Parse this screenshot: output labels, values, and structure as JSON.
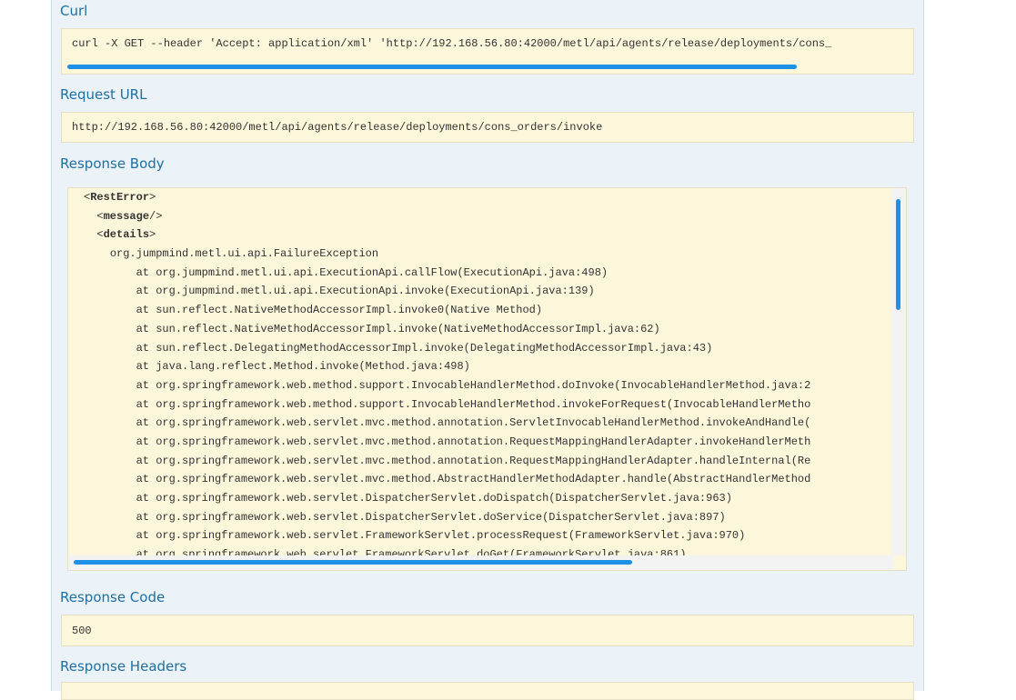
{
  "sections": {
    "curl": {
      "heading": "Curl",
      "command": "curl -X GET --header 'Accept: application/xml' 'http://192.168.56.80:42000/metl/api/agents/release/deployments/cons_"
    },
    "request_url": {
      "heading": "Request URL",
      "value": "http://192.168.56.80:42000/metl/api/agents/release/deployments/cons_orders/invoke"
    },
    "response_body": {
      "heading": "Response Body",
      "lines": [
        {
          "indent": "",
          "open": "<",
          "tag": "RestError",
          "close": ">",
          "text": ""
        },
        {
          "indent": "  ",
          "open": "<",
          "tag": "message",
          "close": "/>",
          "text": ""
        },
        {
          "indent": "  ",
          "open": "<",
          "tag": "details",
          "close": ">",
          "text": ""
        },
        {
          "indent": "    ",
          "open": "",
          "tag": "",
          "close": "",
          "text": "org.jumpmind.metl.ui.api.FailureException"
        },
        {
          "indent": "        ",
          "open": "",
          "tag": "",
          "close": "",
          "text": "at org.jumpmind.metl.ui.api.ExecutionApi.callFlow(ExecutionApi.java:498)"
        },
        {
          "indent": "        ",
          "open": "",
          "tag": "",
          "close": "",
          "text": "at org.jumpmind.metl.ui.api.ExecutionApi.invoke(ExecutionApi.java:139)"
        },
        {
          "indent": "        ",
          "open": "",
          "tag": "",
          "close": "",
          "text": "at sun.reflect.NativeMethodAccessorImpl.invoke0(Native Method)"
        },
        {
          "indent": "        ",
          "open": "",
          "tag": "",
          "close": "",
          "text": "at sun.reflect.NativeMethodAccessorImpl.invoke(NativeMethodAccessorImpl.java:62)"
        },
        {
          "indent": "        ",
          "open": "",
          "tag": "",
          "close": "",
          "text": "at sun.reflect.DelegatingMethodAccessorImpl.invoke(DelegatingMethodAccessorImpl.java:43)"
        },
        {
          "indent": "        ",
          "open": "",
          "tag": "",
          "close": "",
          "text": "at java.lang.reflect.Method.invoke(Method.java:498)"
        },
        {
          "indent": "        ",
          "open": "",
          "tag": "",
          "close": "",
          "text": "at org.springframework.web.method.support.InvocableHandlerMethod.doInvoke(InvocableHandlerMethod.java:2"
        },
        {
          "indent": "        ",
          "open": "",
          "tag": "",
          "close": "",
          "text": "at org.springframework.web.method.support.InvocableHandlerMethod.invokeForRequest(InvocableHandlerMetho"
        },
        {
          "indent": "        ",
          "open": "",
          "tag": "",
          "close": "",
          "text": "at org.springframework.web.servlet.mvc.method.annotation.ServletInvocableHandlerMethod.invokeAndHandle("
        },
        {
          "indent": "        ",
          "open": "",
          "tag": "",
          "close": "",
          "text": "at org.springframework.web.servlet.mvc.method.annotation.RequestMappingHandlerAdapter.invokeHandlerMeth"
        },
        {
          "indent": "        ",
          "open": "",
          "tag": "",
          "close": "",
          "text": "at org.springframework.web.servlet.mvc.method.annotation.RequestMappingHandlerAdapter.handleInternal(Re"
        },
        {
          "indent": "        ",
          "open": "",
          "tag": "",
          "close": "",
          "text": "at org.springframework.web.servlet.mvc.method.AbstractHandlerMethodAdapter.handle(AbstractHandlerMethod"
        },
        {
          "indent": "        ",
          "open": "",
          "tag": "",
          "close": "",
          "text": "at org.springframework.web.servlet.DispatcherServlet.doDispatch(DispatcherServlet.java:963)"
        },
        {
          "indent": "        ",
          "open": "",
          "tag": "",
          "close": "",
          "text": "at org.springframework.web.servlet.DispatcherServlet.doService(DispatcherServlet.java:897)"
        },
        {
          "indent": "        ",
          "open": "",
          "tag": "",
          "close": "",
          "text": "at org.springframework.web.servlet.FrameworkServlet.processRequest(FrameworkServlet.java:970)"
        },
        {
          "indent": "        ",
          "open": "",
          "tag": "",
          "close": "",
          "text": "at org.springframework.web.servlet.FrameworkServlet.doGet(FrameworkServlet.java:861)"
        }
      ]
    },
    "response_code": {
      "heading": "Response Code",
      "value": "500"
    },
    "response_headers": {
      "heading": "Response Headers"
    }
  },
  "colors": {
    "heading": "#1d6fa5",
    "code_background": "#fcf6db",
    "panel_background": "#ebf3f9",
    "scrollbar": "#1e90e6"
  }
}
